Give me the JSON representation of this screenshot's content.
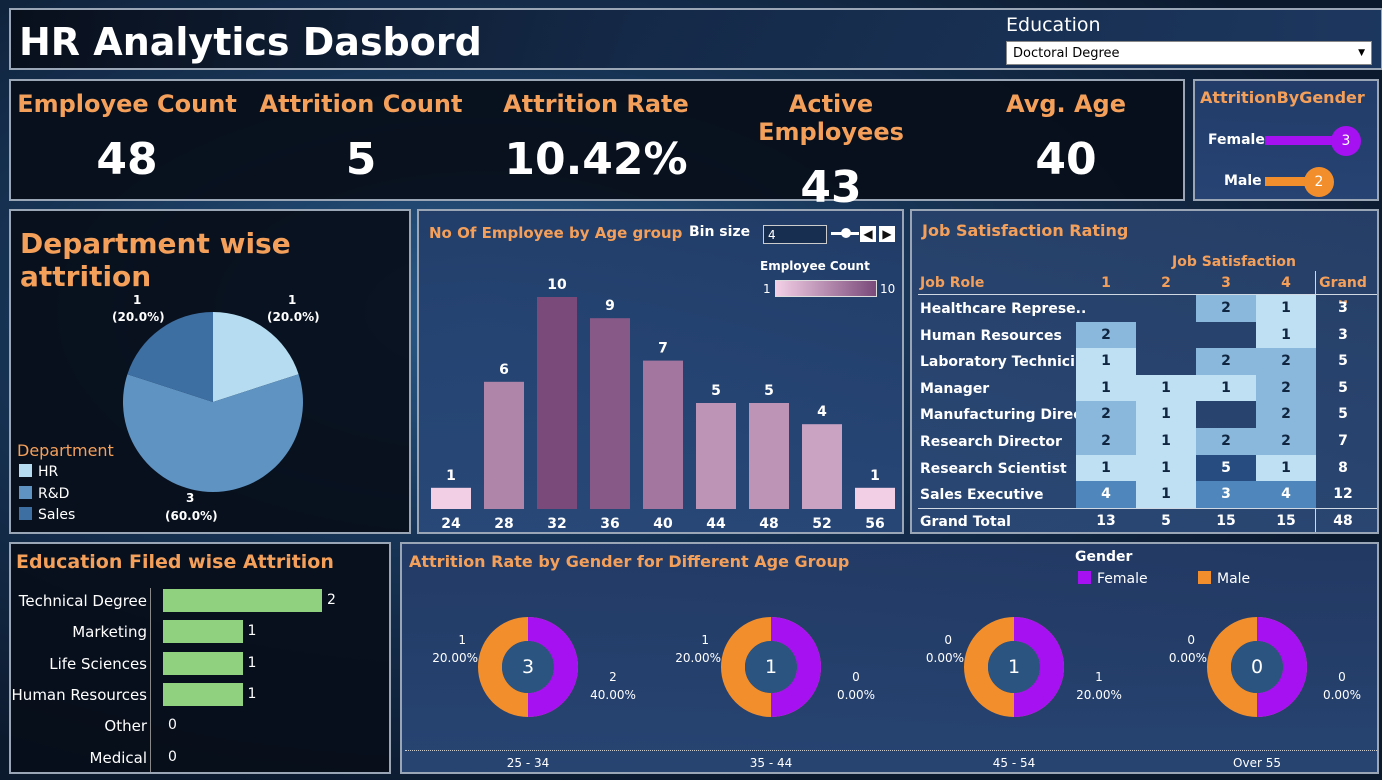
{
  "title": "HR Analytics Dasbord",
  "filter": {
    "label": "Education",
    "value": "Doctoral Degree"
  },
  "kpis": [
    {
      "title": "Employee Count",
      "value": "48"
    },
    {
      "title": "Attrition Count",
      "value": "5"
    },
    {
      "title": "Attrition Rate",
      "value": "10.42%"
    },
    {
      "title": "Active Employees",
      "value": "43"
    },
    {
      "title": "Avg. Age",
      "value": "40"
    }
  ],
  "gender_panel": {
    "title": "AttritionByGender",
    "items": [
      {
        "label": "Female",
        "value": "3",
        "color": "#a511f0"
      },
      {
        "label": "Male",
        "value": "2",
        "color": "#f28e2b"
      }
    ]
  },
  "dept": {
    "title": "Department wise attrition",
    "legend_title": "Department",
    "labels": [
      {
        "count": "1",
        "pct": "(20.0%)"
      },
      {
        "count": "1",
        "pct": "(20.0%)"
      },
      {
        "count": "3",
        "pct": "(60.0%)"
      }
    ]
  },
  "age": {
    "title": "No Of Employee by Age group",
    "bin_label": "Bin size",
    "bin_value": "4",
    "legend_title": "Employee Count",
    "legend_min": "1",
    "legend_max": "10"
  },
  "job": {
    "title": "Job Satisfaction Rating",
    "col_title": "Job Satisfaction",
    "row_header": "Job Role",
    "cols": [
      "1",
      "2",
      "3",
      "4",
      "Grand .."
    ],
    "rows": [
      {
        "role": "Healthcare Represe..",
        "vals": [
          "",
          "",
          "2",
          "1"
        ],
        "total": "3"
      },
      {
        "role": "Human Resources",
        "vals": [
          "2",
          "",
          "",
          "1"
        ],
        "total": "3"
      },
      {
        "role": "Laboratory Technici..",
        "vals": [
          "1",
          "",
          "2",
          "2"
        ],
        "total": "5"
      },
      {
        "role": "Manager",
        "vals": [
          "1",
          "1",
          "1",
          "2"
        ],
        "total": "5"
      },
      {
        "role": "Manufacturing Direc..",
        "vals": [
          "2",
          "1",
          "",
          "2"
        ],
        "total": "5"
      },
      {
        "role": "Research Director",
        "vals": [
          "2",
          "1",
          "2",
          "2"
        ],
        "total": "7"
      },
      {
        "role": "Research Scientist",
        "vals": [
          "1",
          "1",
          "5",
          "1"
        ],
        "total": "8"
      },
      {
        "role": "Sales Executive",
        "vals": [
          "4",
          "1",
          "3",
          "4"
        ],
        "total": "12"
      }
    ],
    "grand": {
      "label": "Grand Total",
      "vals": [
        "13",
        "5",
        "15",
        "15"
      ],
      "total": "48"
    }
  },
  "edu": {
    "title": "Education Filed wise Attrition"
  },
  "gender_age": {
    "title": "Attrition Rate by Gender for Different Age Group",
    "legend_title": "Gender",
    "legend": [
      {
        "label": "Female",
        "color": "#a511f0"
      },
      {
        "label": "Male",
        "color": "#f28e2b"
      }
    ],
    "groups": [
      {
        "name": "25 - 34",
        "center": "3",
        "male_count": "1",
        "male_pct": "20.00%",
        "female_count": "2",
        "female_pct": "40.00%"
      },
      {
        "name": "35 - 44",
        "center": "1",
        "male_count": "1",
        "male_pct": "20.00%",
        "female_count": "0",
        "female_pct": "0.00%"
      },
      {
        "name": "45 - 54",
        "center": "1",
        "male_count": "0",
        "male_pct": "0.00%",
        "female_count": "1",
        "female_pct": "20.00%"
      },
      {
        "name": "Over 55",
        "center": "0",
        "male_count": "0",
        "male_pct": "0.00%",
        "female_count": "0",
        "female_pct": "0.00%"
      }
    ]
  },
  "chart_data": [
    {
      "type": "pie",
      "categories": [
        "HR",
        "R&D",
        "Sales"
      ],
      "values": [
        1,
        3,
        1
      ],
      "colors": [
        "#b5dcf0",
        "#5f93c2",
        "#3d6fa3"
      ]
    },
    {
      "type": "bar",
      "categories": [
        "24",
        "28",
        "32",
        "36",
        "40",
        "44",
        "48",
        "52",
        "56"
      ],
      "values": [
        1,
        6,
        10,
        9,
        7,
        5,
        5,
        4,
        1
      ]
    },
    {
      "type": "bar",
      "orientation": "horizontal",
      "categories": [
        "Technical Degree",
        "Marketing",
        "Life Sciences",
        "Human Resources",
        "Other",
        "Medical"
      ],
      "values": [
        2,
        1,
        1,
        1,
        0,
        0
      ]
    }
  ]
}
